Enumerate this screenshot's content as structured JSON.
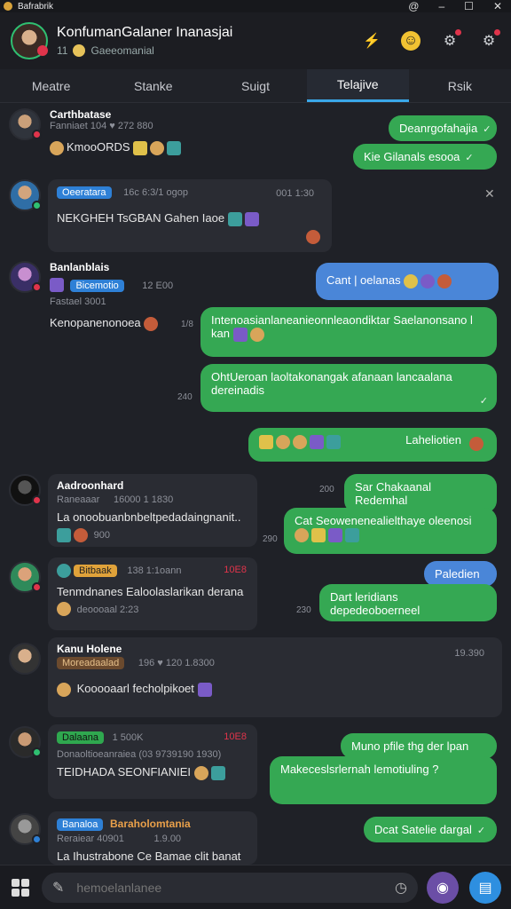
{
  "window": {
    "title": "Bafrabrik",
    "controls": [
      "@",
      "–",
      "☐",
      "✕"
    ]
  },
  "header": {
    "title": "KonfumanGalaner Inanasjai",
    "sub_count": "11",
    "sub_label": "Gaeeomanial"
  },
  "tabs": [
    {
      "label": "Meatre",
      "active": false
    },
    {
      "label": "Stanke",
      "active": false
    },
    {
      "label": "Suigt",
      "active": false
    },
    {
      "label": "Telajive",
      "active": true
    },
    {
      "label": "Rsik",
      "active": false
    }
  ],
  "messages": {
    "m1": {
      "name": "Carthbatase",
      "meta": "Fanniaet  104  ♥ 272  880",
      "text": "KmooORDS"
    },
    "o1": {
      "text": "Deanrgofahajia"
    },
    "o2": {
      "text": "Kie Gilanals esooa"
    },
    "m2": {
      "tag": "Oeeratara",
      "meta": "16c 6:3/1 ogop",
      "time": "001 1:30",
      "text": "NEKGHEH  TsGBAN Gahen  Iaoe"
    },
    "m3": {
      "name": "Banlanblais",
      "tag": "Bicemotio",
      "meta": "12  E00",
      "sub": "Fastael  3001",
      "text": "Kenopanenonoea",
      "time": "1/8"
    },
    "o3": {
      "text": "Cant | oelanas"
    },
    "o4": {
      "text": "Intenoasianlaneanieonnleaondiktar Saelanonsano l kan"
    },
    "o5": {
      "text": "OhtUeroan laoltakonangak afanaan lancaalana dereinadis",
      "time": "240"
    },
    "o6": {
      "text": "Laheliotien"
    },
    "m4": {
      "name": "Aadroonhard",
      "sub": "Raneaaar",
      "meta": "16000   1 1830",
      "text": "La onoobuanbnbeltpedadaingnanit..",
      "sub2": "900"
    },
    "o7": {
      "text": "Sar Chakaanal Redemhal",
      "time": "200"
    },
    "o8": {
      "text": "Cat Seowenenealielthaye oleenosi",
      "time": "290"
    },
    "m5": {
      "tag": "Bitbaak",
      "meta": "138 1:1oann",
      "flag": "10E8",
      "text": "Tenmdnanes Ealoolaslarikan derana",
      "sub": "deoooaal  2:23"
    },
    "o9": {
      "text": "Paledien"
    },
    "o10": {
      "text": "Dart leridians depedeoboerneel",
      "time": "230"
    },
    "m6": {
      "name": "Kanu Holene",
      "tag": "Moreadaalad",
      "meta": "196   ♥ 120 1.8300",
      "text": "Kooooaarl  fecholpikoet",
      "right_meta": "19.390"
    },
    "m7": {
      "tag": "Dalaana",
      "meta": "1 500K",
      "flag": "10E8",
      "sub": "Donaoltioeanraiea  (03 9739190 1930)",
      "text": "TEIDHADA SEONFIANIEI"
    },
    "o11": {
      "text": "Muno pfile thg der lpan"
    },
    "o12": {
      "text": "Makeceslsrlernah lemotiuling ?"
    },
    "m8": {
      "tag": "Banaloa",
      "name": "Baraholomtania",
      "sub": "Reraiear  40901",
      "meta": "1.9.00",
      "text": "La Ihustrabone Ce Bamae clit banat"
    },
    "o13": {
      "text": "Dcat Satelie dargal"
    }
  },
  "composer": {
    "placeholder": "hemoelanlanee"
  },
  "colors": {
    "outgoing": "#35a853",
    "accent": "#3aa7e8",
    "outgoing_alt": "#4a86d8"
  }
}
